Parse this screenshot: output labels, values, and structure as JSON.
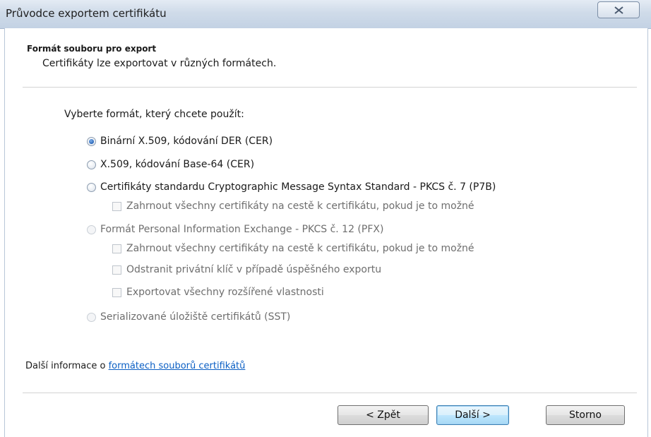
{
  "window": {
    "title": "Průvodce exportem certifikátu"
  },
  "header": {
    "heading": "Formát souboru pro export",
    "subheading": "Certifikáty lze exportovat v různých formátech."
  },
  "form": {
    "prompt": "Vyberte formát, který chcete použít:",
    "options": [
      {
        "label": "Binární X.509, kódování DER (CER)",
        "selected": true,
        "enabled": true
      },
      {
        "label": "X.509, kódování Base-64 (CER)",
        "selected": false,
        "enabled": true
      },
      {
        "label": "Certifikáty standardu Cryptographic Message Syntax Standard - PKCS č. 7 (P7B)",
        "selected": false,
        "enabled": true
      },
      {
        "label": "Formát Personal Information Exchange - PKCS č. 12 (PFX)",
        "selected": false,
        "enabled": false
      },
      {
        "label": "Serializované úložiště certifikátů (SST)",
        "selected": false,
        "enabled": false
      }
    ],
    "p7b_include_all": "Zahrnout všechny certifikáty na cestě k certifikátu, pokud je to možné",
    "pfx_include_all": "Zahrnout všechny certifikáty na cestě k certifikátu, pokud je to možné",
    "pfx_delete_key": "Odstranit privátní klíč v případě úspěšného exportu",
    "pfx_export_props": "Exportovat všechny rozšířené vlastnosti"
  },
  "info": {
    "prefix": "Další informace o ",
    "link": "formátech souborů certifikátů"
  },
  "buttons": {
    "back": "< Zpět",
    "next": "Další >",
    "cancel": "Storno"
  },
  "colors": {
    "accent": "#2a66b8",
    "link": "#0b5fc4",
    "disabled_text": "#6e6e6e"
  }
}
